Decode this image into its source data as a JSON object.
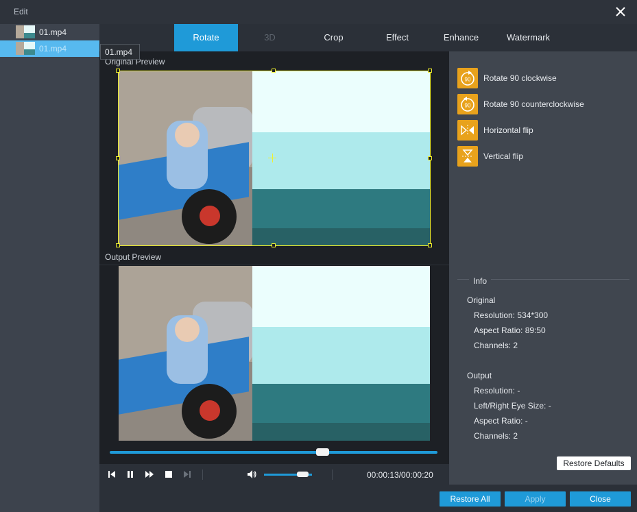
{
  "window": {
    "title": "Edit"
  },
  "files": [
    {
      "name": "01.mp4",
      "selected": false
    },
    {
      "name": "01.mp4",
      "selected": true
    }
  ],
  "tooltip": "01.mp4",
  "tabs": [
    {
      "label": "Rotate",
      "state": "active"
    },
    {
      "label": "3D",
      "state": "disabled"
    },
    {
      "label": "Crop",
      "state": "normal"
    },
    {
      "label": "Effect",
      "state": "normal"
    },
    {
      "label": "Enhance",
      "state": "normal"
    },
    {
      "label": "Watermark",
      "state": "normal"
    }
  ],
  "preview": {
    "original_label": "Original Preview",
    "output_label": "Output Preview"
  },
  "player": {
    "progress": 0.65,
    "volume": 0.8,
    "timecode": "00:00:13/00:00:20"
  },
  "rotate_actions": [
    {
      "label": "Rotate 90 clockwise",
      "icon": "rotate-clockwise-icon"
    },
    {
      "label": "Rotate 90 counterclockwise",
      "icon": "rotate-counterclockwise-icon"
    },
    {
      "label": "Horizontal flip",
      "icon": "horizontal-flip-icon"
    },
    {
      "label": "Vertical flip",
      "icon": "vertical-flip-icon"
    }
  ],
  "info": {
    "title": "Info",
    "original": {
      "heading": "Original",
      "resolution": "Resolution: 534*300",
      "aspect_ratio": "Aspect Ratio: 89:50",
      "channels": "Channels: 2"
    },
    "output": {
      "heading": "Output",
      "resolution": "Resolution: -",
      "eye_size": "Left/Right Eye Size: -",
      "aspect_ratio": "Aspect Ratio: -",
      "channels": "Channels: 2"
    }
  },
  "buttons": {
    "restore_defaults": "Restore Defaults",
    "restore_all": "Restore All",
    "apply": "Apply",
    "close": "Close"
  },
  "colors": {
    "accent": "#1f9ad8",
    "icon_orange": "#e8a21c",
    "crop_yellow": "#f1f12c",
    "selected_file": "#57b9ef"
  }
}
